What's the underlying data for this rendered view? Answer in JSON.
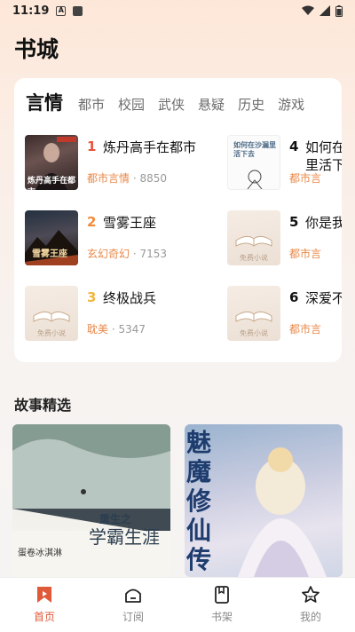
{
  "status_bar": {
    "time": "11:19",
    "a_badge": "A"
  },
  "page": {
    "title": "书城"
  },
  "rank": {
    "tabs": [
      {
        "label": "言情",
        "active": true
      },
      {
        "label": "都市"
      },
      {
        "label": "校园"
      },
      {
        "label": "武侠"
      },
      {
        "label": "悬疑"
      },
      {
        "label": "历史"
      },
      {
        "label": "游戏"
      }
    ],
    "books": [
      {
        "rank": "1",
        "title": "炼丹高手在都市",
        "category": "都市言情",
        "count": "8850",
        "cover_text": "炼丹高手在都市",
        "rank_color": "#e8553f"
      },
      {
        "rank": "2",
        "title": "雪雾王座",
        "category": "玄幻奇幻",
        "count": "7153",
        "cover_text": "雪雾王座",
        "rank_color": "#f08a3c"
      },
      {
        "rank": "3",
        "title": "终极战兵",
        "category": "耽美",
        "count": "5347",
        "cover_text": "免费小说",
        "rank_color": "#f2b640"
      },
      {
        "rank": "4",
        "title": "如何在",
        "title2": "里活下",
        "category": "都市言",
        "count": "",
        "cover_text": "如何在沙漏里活下去",
        "rank_color": "#111111"
      },
      {
        "rank": "5",
        "title": "你是我",
        "category": "都市言",
        "count": "",
        "cover_text": "免费小说",
        "rank_color": "#111111"
      },
      {
        "rank": "6",
        "title": "深爱不",
        "category": "都市言",
        "count": "",
        "cover_text": "免费小说",
        "rank_color": "#111111"
      }
    ]
  },
  "stories": {
    "title": "故事精选",
    "items": [
      {
        "title": "重生之学霸生涯",
        "subtitle": "重生之",
        "main": "学霸生涯",
        "author": "蛋卷冰淇淋"
      },
      {
        "title": "魅魔修仙传",
        "main": "魅魔修仙传"
      }
    ]
  },
  "bottom_nav": [
    {
      "label": "首页",
      "icon": "home-bookmark-icon",
      "active": true
    },
    {
      "label": "订阅",
      "icon": "subscribe-icon"
    },
    {
      "label": "书架",
      "icon": "bookshelf-icon"
    },
    {
      "label": "我的",
      "icon": "star-profile-icon"
    }
  ],
  "colors": {
    "accent": "#e05a3a",
    "category": "#e8894a"
  }
}
